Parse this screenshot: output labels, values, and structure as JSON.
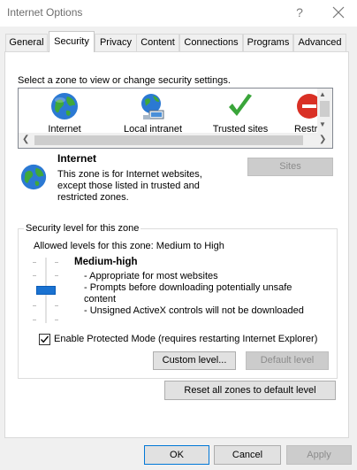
{
  "window": {
    "title": "Internet Options",
    "help_glyph": "?",
    "close_icon": "close-icon"
  },
  "tabs": [
    {
      "label": "General"
    },
    {
      "label": "Security",
      "active": true
    },
    {
      "label": "Privacy"
    },
    {
      "label": "Content"
    },
    {
      "label": "Connections"
    },
    {
      "label": "Programs"
    },
    {
      "label": "Advanced"
    }
  ],
  "zones": {
    "prompt": "Select a zone to view or change security settings.",
    "items": [
      {
        "label": "Internet",
        "icon": "globe-icon"
      },
      {
        "label": "Local intranet",
        "icon": "network-icon"
      },
      {
        "label": "Trusted sites",
        "icon": "checkmark-icon"
      },
      {
        "label": "Restr",
        "icon": "restricted-icon"
      }
    ]
  },
  "selected_zone": {
    "heading": "Internet",
    "description": [
      "This zone is for Internet websites,",
      "except those listed in trusted and",
      "restricted zones."
    ],
    "sites_button": "Sites"
  },
  "security_level": {
    "legend": "Security level for this zone",
    "allowed": "Allowed levels for this zone: Medium to High",
    "slider_level": "Medium-high",
    "title": "Medium-high",
    "lines": [
      "- Appropriate for most websites",
      "- Prompts before downloading potentially unsafe",
      "  content",
      "- Unsigned ActiveX controls will not be downloaded"
    ]
  },
  "protected_mode": {
    "checked": true,
    "label": "Enable Protected Mode (requires restarting Internet Explorer)"
  },
  "buttons": {
    "custom_level": "Custom level...",
    "default_level": "Default level",
    "reset_all": "Reset all zones to default level",
    "ok": "OK",
    "cancel": "Cancel",
    "apply": "Apply"
  },
  "colors": {
    "accent": "#0078d7",
    "slider_thumb": "#1a72d1"
  }
}
